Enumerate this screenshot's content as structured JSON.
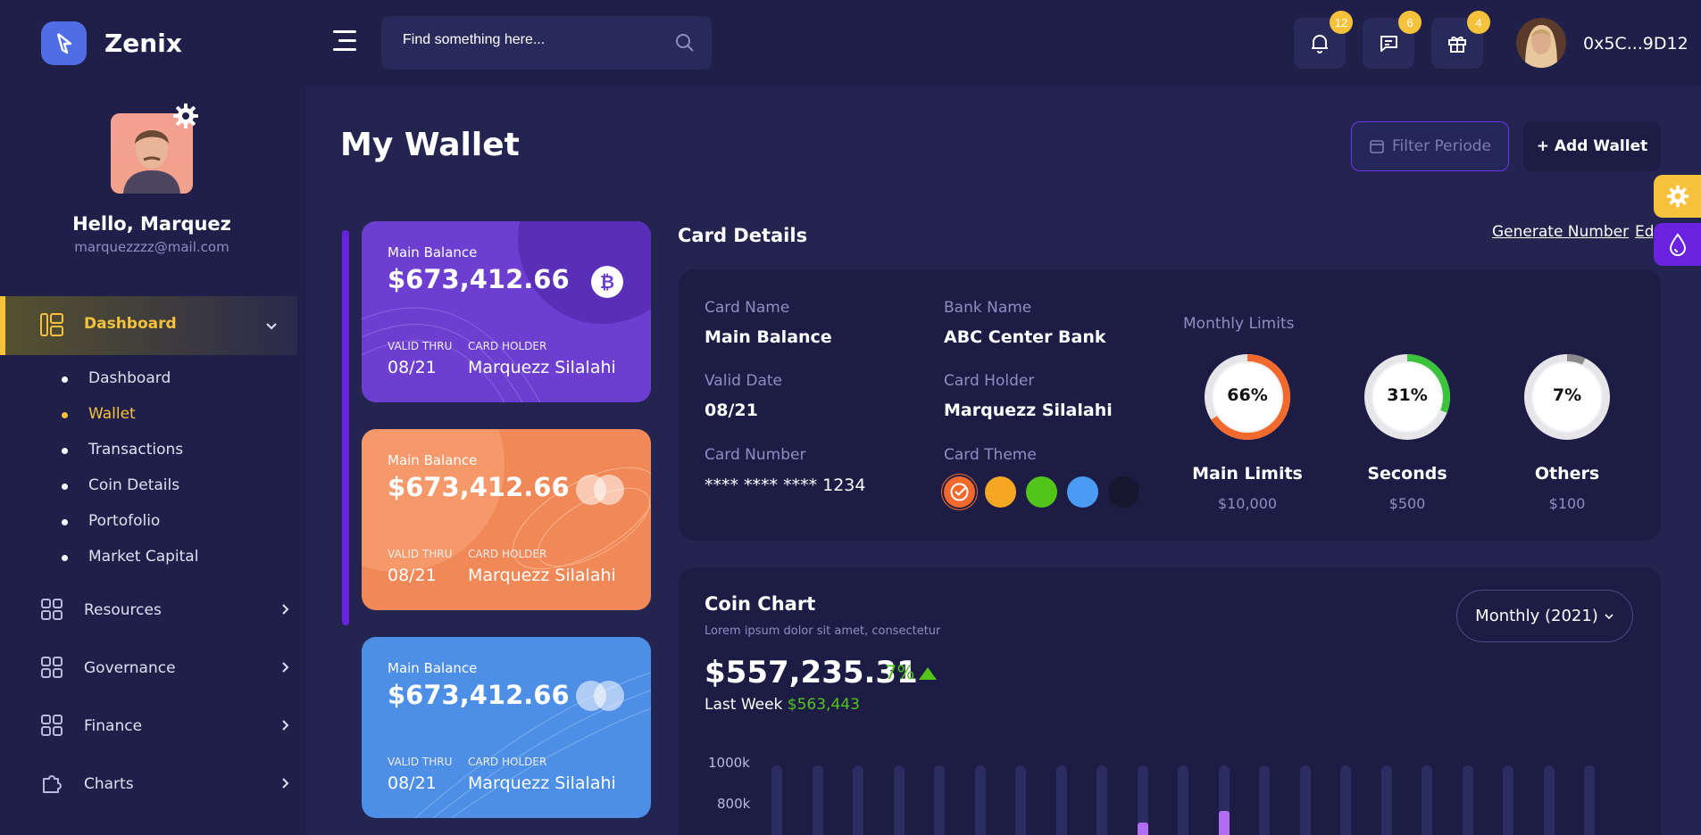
{
  "app": {
    "name": "Zenix"
  },
  "header": {
    "search_placeholder": "Find something here...",
    "notifications_count": "12",
    "messages_count": "6",
    "gifts_count": "4",
    "wallet_address": "0x5C...9D12"
  },
  "profile": {
    "greeting": "Hello, Marquez",
    "email": "marquezzzz@mail.com"
  },
  "sidebar": {
    "active_section": "Dashboard",
    "subitems": [
      "Dashboard",
      "Wallet",
      "Transactions",
      "Coin Details",
      "Portofolio",
      "Market Capital"
    ],
    "active_subitem": "Wallet",
    "sections": [
      "Resources",
      "Governance",
      "Finance",
      "Charts"
    ]
  },
  "page": {
    "title": "My Wallet",
    "filter_label": "Filter Periode",
    "add_label": "+ Add Wallet"
  },
  "cards": [
    {
      "label": "Main Balance",
      "amount": "$673,412.66",
      "valid_label": "VALID THRU",
      "valid": "08/21",
      "holder_label": "CARD HOLDER",
      "holder": "Marquezz Silalahi"
    },
    {
      "label": "Main Balance",
      "amount": "$673,412.66",
      "valid_label": "VALID THRU",
      "valid": "08/21",
      "holder_label": "CARD HOLDER",
      "holder": "Marquezz Silalahi"
    },
    {
      "label": "Main Balance",
      "amount": "$673,412.66",
      "valid_label": "VALID THRU",
      "valid": "08/21",
      "holder_label": "CARD HOLDER",
      "holder": "Marquezz Silalahi"
    }
  ],
  "card_details": {
    "title": "Card Details",
    "generate_label": "Generate Number",
    "edit_label": "Edit",
    "card_name_label": "Card Name",
    "card_name": "Main Balance",
    "bank_name_label": "Bank Name",
    "bank_name": "ABC Center Bank",
    "valid_date_label": "Valid Date",
    "valid_date": "08/21",
    "card_holder_label": "Card Holder",
    "card_holder": "Marquezz Silalahi",
    "card_number_label": "Card Number",
    "card_number": "**** **** **** 1234",
    "card_theme_label": "Card Theme",
    "theme_colors": [
      "#f26a2b",
      "#f5a623",
      "#52c41a",
      "#4a9cf2",
      "#16172e"
    ],
    "monthly_limits_label": "Monthly Limits",
    "limits": [
      {
        "percent_label": "66%",
        "percent": 66,
        "name": "Main Limits",
        "amount": "$10,000",
        "color": "#f26a2b"
      },
      {
        "percent_label": "31%",
        "percent": 31,
        "name": "Seconds",
        "amount": "$500",
        "color": "#3bc43b"
      },
      {
        "percent_label": "7%",
        "percent": 7,
        "name": "Others",
        "amount": "$100",
        "color": "#8a8a8a"
      }
    ]
  },
  "coin_chart": {
    "title": "Coin Chart",
    "subtitle": "Lorem ipsum dolor sit amet, consectetur",
    "period": "Monthly (2021)",
    "amount": "$557,235.31",
    "change": "7%",
    "last_week_label": "Last Week",
    "last_week_value": "$563,443"
  },
  "chart_data": {
    "type": "bar",
    "y_ticks": [
      "1000k",
      "800k"
    ],
    "accent": "#b06ff2",
    "bars_visible": 21,
    "highlight_values_k": [
      {
        "index": 9,
        "value": 710
      },
      {
        "index": 11,
        "value": 765
      }
    ]
  }
}
